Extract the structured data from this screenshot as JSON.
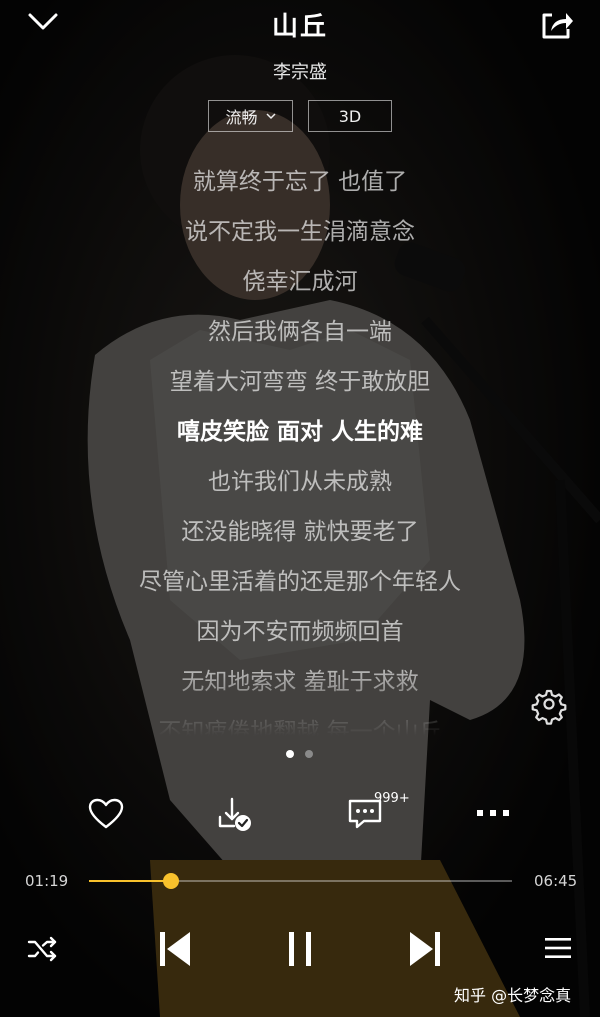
{
  "header": {
    "title": "山丘",
    "artist": "李宗盛"
  },
  "quality": {
    "fluency_label": "流畅",
    "mode_3d_label": "3D"
  },
  "lyrics": [
    "就算终于忘了 也值了",
    "说不定我一生涓滴意念",
    "侥幸汇成河",
    "然后我俩各自一端",
    "望着大河弯弯 终于敢放胆",
    "嘻皮笑脸 面对 人生的难",
    "也许我们从未成熟",
    "还没能晓得 就快要老了",
    "尽管心里活着的还是那个年轻人",
    "因为不安而频频回首",
    "无知地索求 羞耻于求救",
    "不知疲倦地翻越 每一个山丘"
  ],
  "active_lyric_index": 5,
  "pager": {
    "pages": 2,
    "current": 1
  },
  "actions": {
    "comment_count": "999+"
  },
  "playback": {
    "elapsed": "01:19",
    "duration": "06:45",
    "progress": 0.195
  },
  "colors": {
    "accent": "#f8c12c"
  },
  "watermark": "知乎 @长梦念真",
  "icons": {
    "collapse": "chevron-down-icon",
    "share": "share-icon",
    "like": "heart-icon",
    "download": "download-check-icon",
    "comment": "comment-icon",
    "more": "more-icon",
    "settings": "gear-icon",
    "shuffle": "shuffle-icon",
    "previous": "previous-icon",
    "pause": "pause-icon",
    "next": "next-icon",
    "playlist": "playlist-icon"
  }
}
